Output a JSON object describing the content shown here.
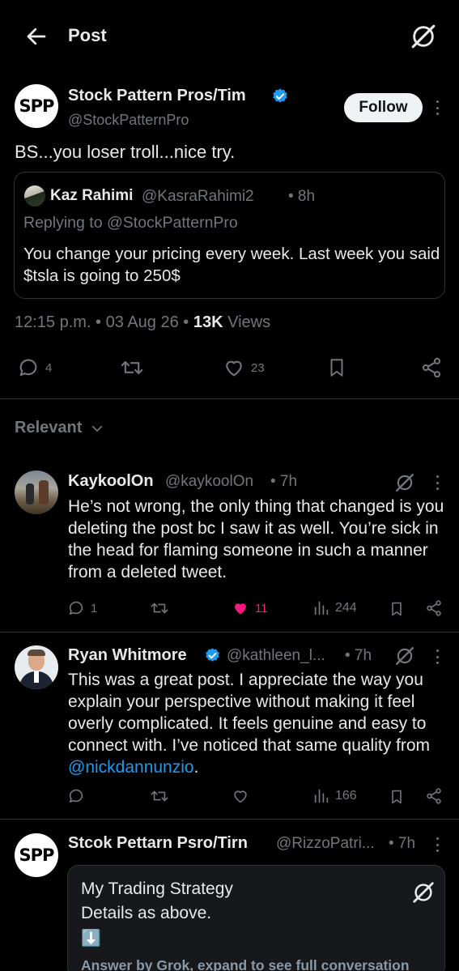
{
  "header": {
    "title": "Post",
    "back_icon": "arrow-left-icon",
    "grok_icon": "grok-icon"
  },
  "post": {
    "author_name": "Stock Pattern Pros/Tim",
    "author_handle": "@StockPatternPro",
    "avatar_text": "SPP",
    "follow_label": "Follow",
    "text": "BS...you loser troll...nice try.",
    "quote": {
      "author_name": "Kaz Rahimi",
      "author_handle": "@KasraRahimi2",
      "time": "• 8h",
      "replying_to": "Replying to @StockPatternPro",
      "text": "You change your pricing every week. Last week you said $tsla is going to 250$"
    },
    "timestamp": "12:15 p.m. • 03 Aug 26 • ",
    "views_count": "13K",
    "views_label": " Views",
    "actions": {
      "replies": "4",
      "reposts": "",
      "likes": "23"
    }
  },
  "filter": {
    "label": "Relevant"
  },
  "replies": [
    {
      "author_name": "KaykoolOn",
      "author_handle": "@kaykoolOn",
      "time": "• 7h",
      "text": "He’s not wrong, the only thing that changed is you deleting the post bc I saw it as well. You’re sick in the head for flaming someone in such a manner from a deleted tweet.",
      "replies": "1",
      "reposts": "",
      "likes": "11",
      "views": "244"
    },
    {
      "author_name": "Ryan Whitmore",
      "author_handle": "@kathleen_l...",
      "time": "• 7h",
      "text_prefix": "This was a great post. I appreciate the way you explain your perspective without making it feel overly complicated. It feels genuine and easy to connect with. I’ve noticed that same quality from ",
      "mention": "@nickdannunzio",
      "text_suffix": ".",
      "replies": "",
      "reposts": "",
      "likes": "",
      "views": "166"
    },
    {
      "author_name": "Stcok Pettarn Psro/Tirn",
      "author_handle": "@RizzoPatri...",
      "time": "• 7h",
      "avatar_text": "SPP",
      "card": {
        "line1": "My Trading Strategy",
        "line2": "Details as above.",
        "emoji": "⬇️",
        "footer": "Answer by Grok, expand to see full conversation"
      }
    }
  ],
  "colors": {
    "background": "#000000",
    "accent": "#1d9bf0",
    "like_active": "#f91880",
    "divider": "#2f3336",
    "muted": "#71767b"
  }
}
